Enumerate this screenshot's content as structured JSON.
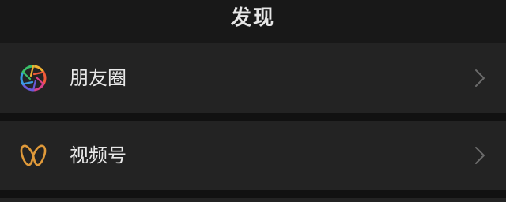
{
  "header": {
    "title": "发现"
  },
  "list": {
    "items": [
      {
        "label": "朋友圈",
        "icon": "moments-aperture-icon"
      },
      {
        "label": "视频号",
        "icon": "channels-butterfly-icon"
      }
    ]
  },
  "colors": {
    "background": "#111111",
    "header_bg": "#181818",
    "row_bg": "#232323",
    "text": "#e8e8e8",
    "chevron": "#6b6b6b",
    "channels_icon": "#e09a3a"
  }
}
